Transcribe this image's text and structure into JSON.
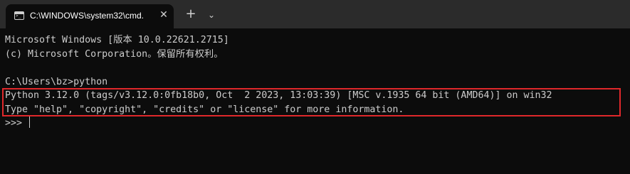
{
  "window": {
    "tab_title": "C:\\WINDOWS\\system32\\cmd.",
    "tab_close": "✕",
    "new_tab": "+",
    "dropdown": "⌄"
  },
  "icons": {
    "tab": "terminal-icon",
    "close": "close-icon",
    "new_tab": "plus-icon",
    "dropdown": "chevron-down-icon"
  },
  "colors": {
    "background": "#0c0c0c",
    "text": "#cccccc",
    "tabbar": "#2b2b2b",
    "highlight": "#e0282b"
  },
  "terminal": {
    "lines": [
      "Microsoft Windows [版本 10.0.22621.2715]",
      "(c) Microsoft Corporation。保留所有权利。",
      "",
      "C:\\Users\\bz>python",
      "Python 3.12.0 (tags/v3.12.0:0fb18b0, Oct  2 2023, 13:03:39) [MSC v.1935 64 bit (AMD64)] on win32",
      "Type \"help\", \"copyright\", \"credits\" or \"license\" for more information.",
      ">>> "
    ]
  }
}
